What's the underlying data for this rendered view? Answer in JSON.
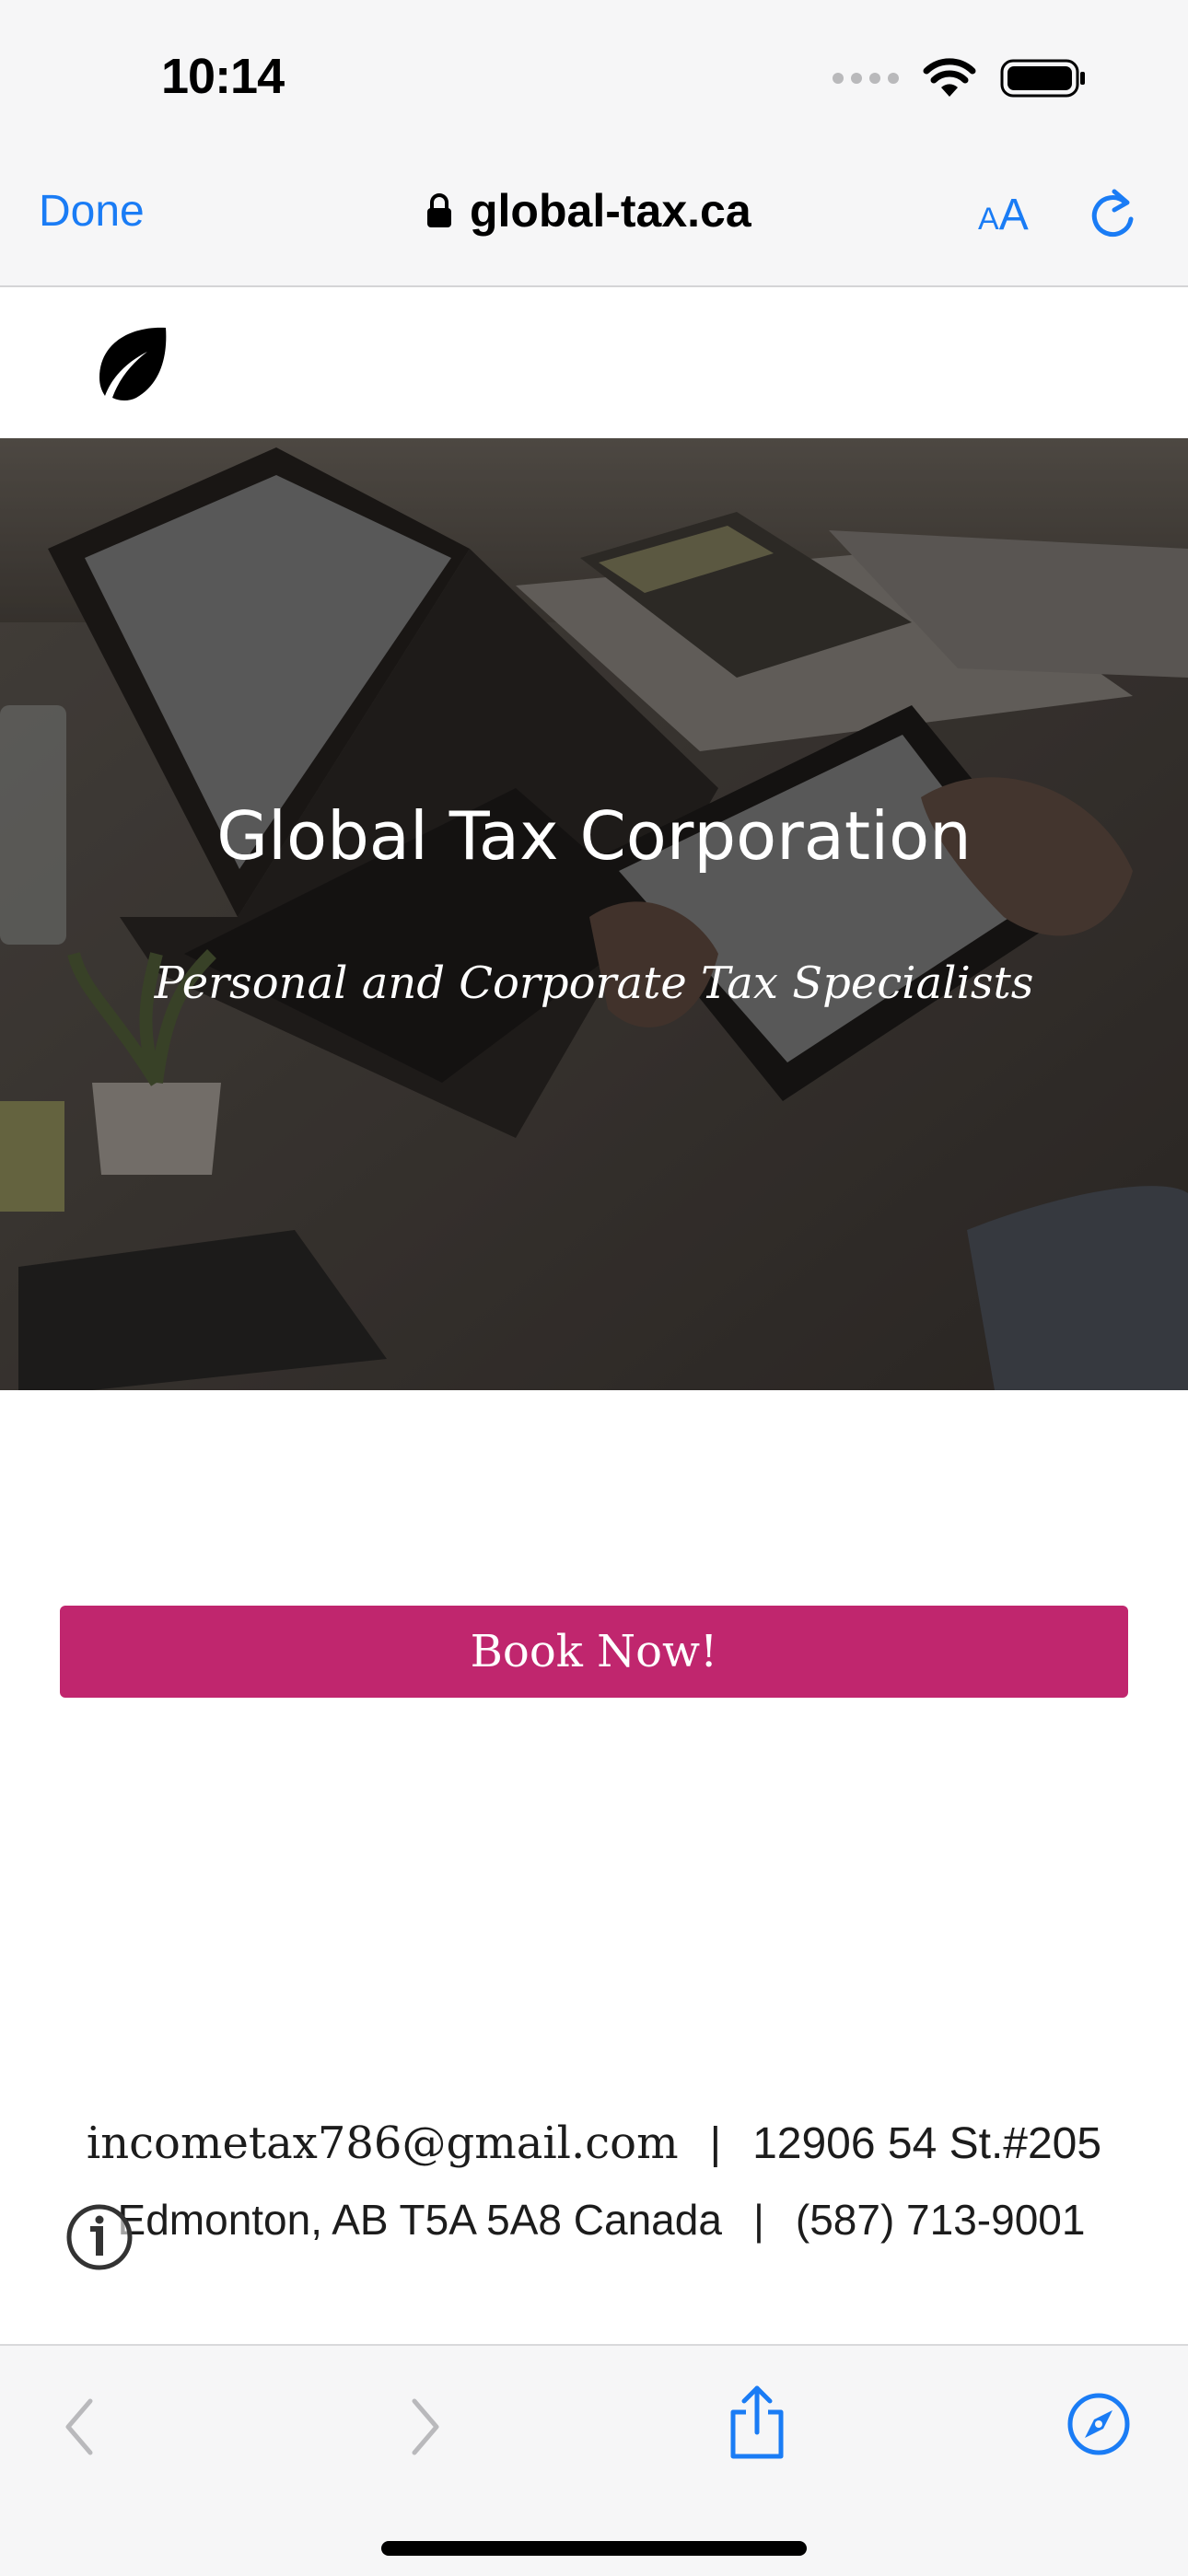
{
  "status_bar": {
    "time": "10:14"
  },
  "browser": {
    "done_label": "Done",
    "url": "global-tax.ca",
    "text_size_small": "A",
    "text_size_big": "A"
  },
  "hero": {
    "title": "Global Tax Corporation",
    "subtitle": "Personal and Corporate Tax Specialists"
  },
  "booking": {
    "button_label": "Book Now!"
  },
  "contact": {
    "email": "incometax786@gmail.com",
    "separator": "|",
    "street": "12906 54 St.#205",
    "city": "Edmonton, AB T5A 5A8 Canada",
    "phone": "(587) 713-9001"
  },
  "colors": {
    "accent_blue": "#1a7cf5",
    "button_magenta": "#c0266e"
  }
}
